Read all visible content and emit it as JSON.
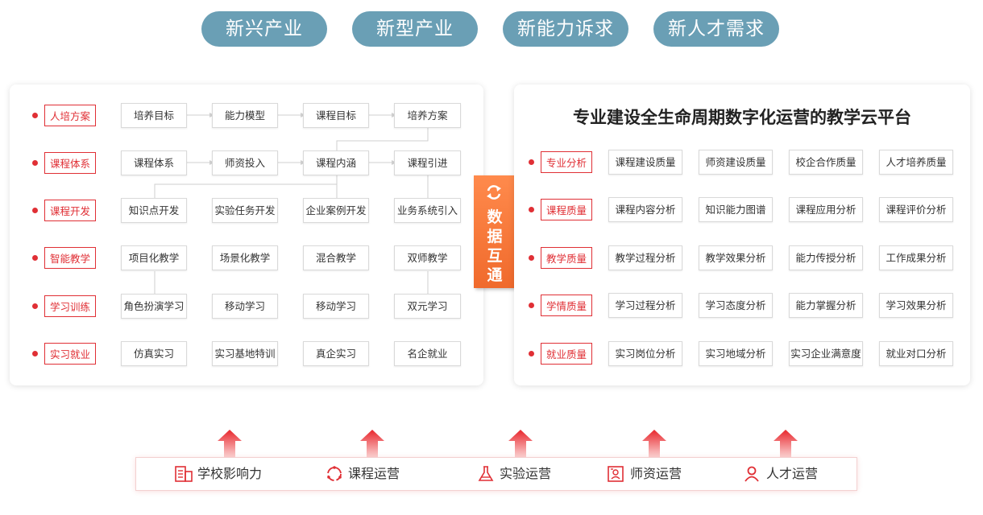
{
  "top_pills": [
    "新兴产业",
    "新型产业",
    "新能力诉求",
    "新人才需求"
  ],
  "left": {
    "rows": [
      {
        "label": "人培方案",
        "items": [
          "培养目标",
          "能力模型",
          "课程目标",
          "培养方案"
        ]
      },
      {
        "label": "课程体系",
        "items": [
          "课程体系",
          "师资投入",
          "课程内涵",
          "课程引进"
        ]
      },
      {
        "label": "课程开发",
        "items": [
          "知识点开发",
          "实验任务开发",
          "企业案例开发",
          "业务系统引入"
        ]
      },
      {
        "label": "智能教学",
        "items": [
          "项目化教学",
          "场景化教学",
          "混合教学",
          "双师教学"
        ]
      },
      {
        "label": "学习训练",
        "items": [
          "角色扮演学习",
          "移动学习",
          "移动学习",
          "双元学习"
        ]
      },
      {
        "label": "实习就业",
        "items": [
          "仿真实习",
          "实习基地特训",
          "真企实习",
          "名企就业"
        ]
      }
    ]
  },
  "sync": {
    "text": "数据互通",
    "icon": "sync-icon"
  },
  "right": {
    "title": "专业建设全生命周期数字化运营的教学云平台",
    "rows": [
      {
        "label": "专业分析",
        "items": [
          "课程建设质量",
          "师资建设质量",
          "校企合作质量",
          "人才培养质量"
        ]
      },
      {
        "label": "课程质量",
        "items": [
          "课程内容分析",
          "知识能力图谱",
          "课程应用分析",
          "课程评价分析"
        ]
      },
      {
        "label": "教学质量",
        "items": [
          "教学过程分析",
          "教学效果分析",
          "能力传授分析",
          "工作成果分析"
        ]
      },
      {
        "label": "学情质量",
        "items": [
          "学习过程分析",
          "学习态度分析",
          "能力掌握分析",
          "学习效果分析"
        ]
      },
      {
        "label": "就业质量",
        "items": [
          "实习岗位分析",
          "实习地域分析",
          "实习企业满意度",
          "就业对口分析"
        ]
      }
    ]
  },
  "bottom": {
    "items": [
      {
        "label": "学校影响力",
        "icon": "building-icon"
      },
      {
        "label": "课程运营",
        "icon": "cycle-icon"
      },
      {
        "label": "实验运营",
        "icon": "flask-icon"
      },
      {
        "label": "师资运营",
        "icon": "teacher-card-icon"
      },
      {
        "label": "人才运营",
        "icon": "person-icon"
      }
    ]
  },
  "colors": {
    "accent": "#e02f35",
    "pill": "#6a9fb5",
    "badge": "#f07232"
  }
}
